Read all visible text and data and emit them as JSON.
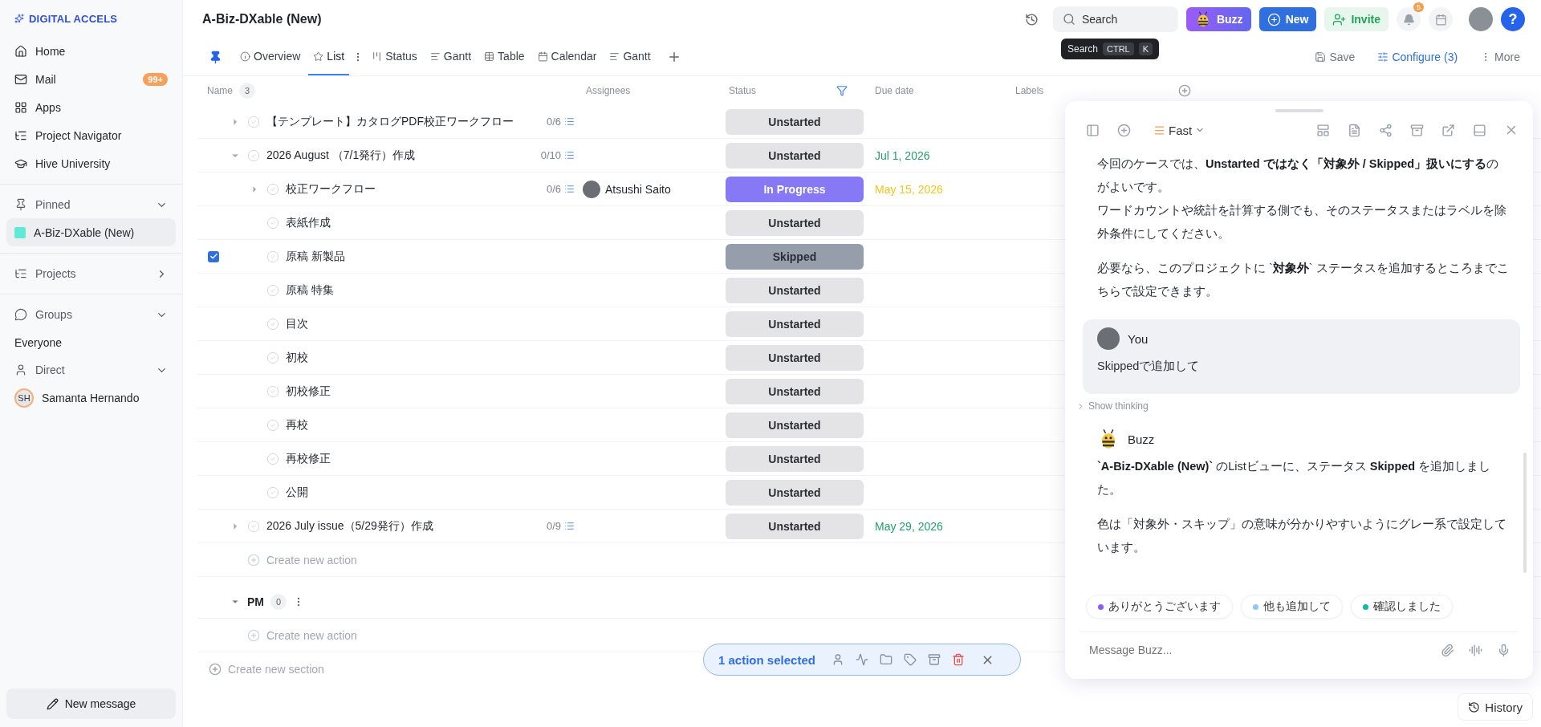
{
  "sidebar": {
    "logo": "DIGITAL ACCELS",
    "nav": [
      {
        "kind": "home",
        "label": "Home"
      },
      {
        "kind": "mail",
        "label": "Mail",
        "badge": "99+"
      },
      {
        "kind": "apps",
        "label": "Apps"
      },
      {
        "kind": "tree",
        "label": "Project Navigator"
      },
      {
        "kind": "school",
        "label": "Hive University"
      }
    ],
    "sections": [
      {
        "kind": "pin",
        "title": "Pinned",
        "expanded": true,
        "items": [
          {
            "label": "A-Biz-DXable (New)",
            "color": "#5eead4",
            "selected": true
          }
        ]
      },
      {
        "kind": "tree",
        "title": "Projects",
        "expanded": false
      },
      {
        "kind": "chat",
        "title": "Groups",
        "expanded": true,
        "items": [
          {
            "label": "Everyone",
            "selected": false
          }
        ]
      },
      {
        "kind": "person",
        "title": "Direct",
        "expanded": true,
        "items": [
          {
            "label": "Samanta Hernando",
            "initials": "SH",
            "selected": false
          }
        ]
      }
    ],
    "new_message": "New message"
  },
  "header": {
    "title": "A-Biz-DXable (New)",
    "search": {
      "placeholder": "Search"
    },
    "tooltip": {
      "label": "Search",
      "keys": [
        "CTRL",
        "K"
      ]
    },
    "buttons": [
      {
        "kind": "buzz",
        "label": "Buzz"
      },
      {
        "kind": "new",
        "label": "New"
      },
      {
        "kind": "invite",
        "label": "Invite"
      }
    ],
    "notifications": "5",
    "help": "?"
  },
  "tabs": [
    {
      "kind": "overview",
      "label": "Overview",
      "selected": false
    },
    {
      "kind": "list",
      "label": "List",
      "selected": true
    },
    {
      "kind": "status",
      "label": "Status",
      "selected": false
    },
    {
      "kind": "gantt",
      "label": "Gantt",
      "selected": false
    },
    {
      "kind": "table",
      "label": "Table",
      "selected": false
    },
    {
      "kind": "calendar",
      "label": "Calendar",
      "selected": false
    },
    {
      "kind": "gantt",
      "label": "Gantt",
      "selected": false
    }
  ],
  "view_actions": [
    {
      "kind": "save",
      "label": "Save"
    },
    {
      "kind": "configure",
      "label": "Configure (3)"
    },
    {
      "kind": "more",
      "label": "More"
    }
  ],
  "table": {
    "columns": [
      {
        "label": "Name",
        "count": "3"
      },
      {
        "label": "Assignees"
      },
      {
        "label": "Status",
        "filtered": true
      },
      {
        "label": "Due date"
      },
      {
        "label": "Labels"
      }
    ],
    "rows": [
      {
        "name": "【テンプレート】カタログPDF校正ワークフロー",
        "progress": "0/6",
        "expanded": false,
        "checked": false,
        "status": {
          "label": "Unstarted",
          "color": "#e4e4e7"
        }
      },
      {
        "name": "2026 August （7/1発行）作成",
        "progress": "0/10",
        "expanded": true,
        "checked": false,
        "status": {
          "label": "Unstarted",
          "color": "#e4e4e7"
        },
        "due": {
          "text": "Jul 1, 2026",
          "color": "#22a06b"
        },
        "children": [
          {
            "name": "校正ワークフロー",
            "progress": "0/6",
            "expanded": false,
            "checked": false,
            "assignee": "Atsushi Saito",
            "status": {
              "label": "In Progress",
              "color": "#8778f5"
            },
            "due": {
              "text": "May 15, 2026",
              "color": "#f5c518"
            }
          },
          {
            "name": "表紙作成",
            "checked": false,
            "status": {
              "label": "Unstarted",
              "color": "#e4e4e7"
            }
          },
          {
            "name": "原稿 新製品",
            "checked": true,
            "status": {
              "label": "Skipped",
              "color": "#979eab"
            }
          },
          {
            "name": "原稿 特集",
            "checked": false,
            "status": {
              "label": "Unstarted",
              "color": "#e4e4e7"
            }
          },
          {
            "name": "目次",
            "checked": false,
            "status": {
              "label": "Unstarted",
              "color": "#e4e4e7"
            }
          },
          {
            "name": "初校",
            "checked": false,
            "status": {
              "label": "Unstarted",
              "color": "#e4e4e7"
            }
          },
          {
            "name": "初校修正",
            "checked": false,
            "status": {
              "label": "Unstarted",
              "color": "#e4e4e7"
            }
          },
          {
            "name": "再校",
            "checked": false,
            "status": {
              "label": "Unstarted",
              "color": "#e4e4e7"
            }
          },
          {
            "name": "再校修正",
            "checked": false,
            "status": {
              "label": "Unstarted",
              "color": "#e4e4e7"
            }
          },
          {
            "name": "公開",
            "checked": false,
            "status": {
              "label": "Unstarted",
              "color": "#e4e4e7"
            }
          }
        ]
      },
      {
        "name": "2026 July issue（5/29発行）作成",
        "progress": "0/9",
        "expanded": false,
        "checked": false,
        "status": {
          "label": "Unstarted",
          "color": "#e4e4e7"
        },
        "due": {
          "text": "May 29, 2026",
          "color": "#22a06b"
        }
      }
    ],
    "create_action": "Create new action",
    "sections": [
      {
        "name": "PM",
        "count": "0",
        "expanded": true,
        "create_action": "Create new action"
      }
    ],
    "create_section": "Create new section"
  },
  "selection_bar": {
    "label": "1 action selected"
  },
  "chat": {
    "mode": "Fast",
    "messages": [
      {
        "kind": "body",
        "paragraphs": [
          [
            "今回のケースでは、**Unstarted ではなく「対象外 / Skipped」扱いにする**のがよいです。",
            "ワードカウントや統計を計算する側でも、そのステータスまたはラベルを除外条件にしてください。"
          ],
          [
            "必要なら、このプロジェクトに `**対象外**` ステータスを追加するところまでこちらで設定できます。"
          ]
        ]
      },
      {
        "kind": "user",
        "author": "You",
        "paragraphs": [
          [
            "Skippedで追加して"
          ]
        ]
      },
      {
        "kind": "thinking",
        "label": "Show thinking"
      },
      {
        "kind": "assistant",
        "author": "Buzz",
        "paragraphs": [
          [
            "**`A-Biz-DXable (New)`** のListビューに、ステータス **Skipped** を追加しました。"
          ],
          [
            "色は「対象外・スキップ」の意味が分かりやすいようにグレー系で設定しています。"
          ]
        ]
      }
    ],
    "suggestions": [
      {
        "label": "ありがとうございます",
        "color": "#8b5cf6"
      },
      {
        "label": "他も追加して",
        "color": "#93c5fd"
      },
      {
        "label": "確認しました",
        "color": "#14b8a6"
      }
    ],
    "placeholder": "Message Buzz...",
    "history": "History"
  }
}
